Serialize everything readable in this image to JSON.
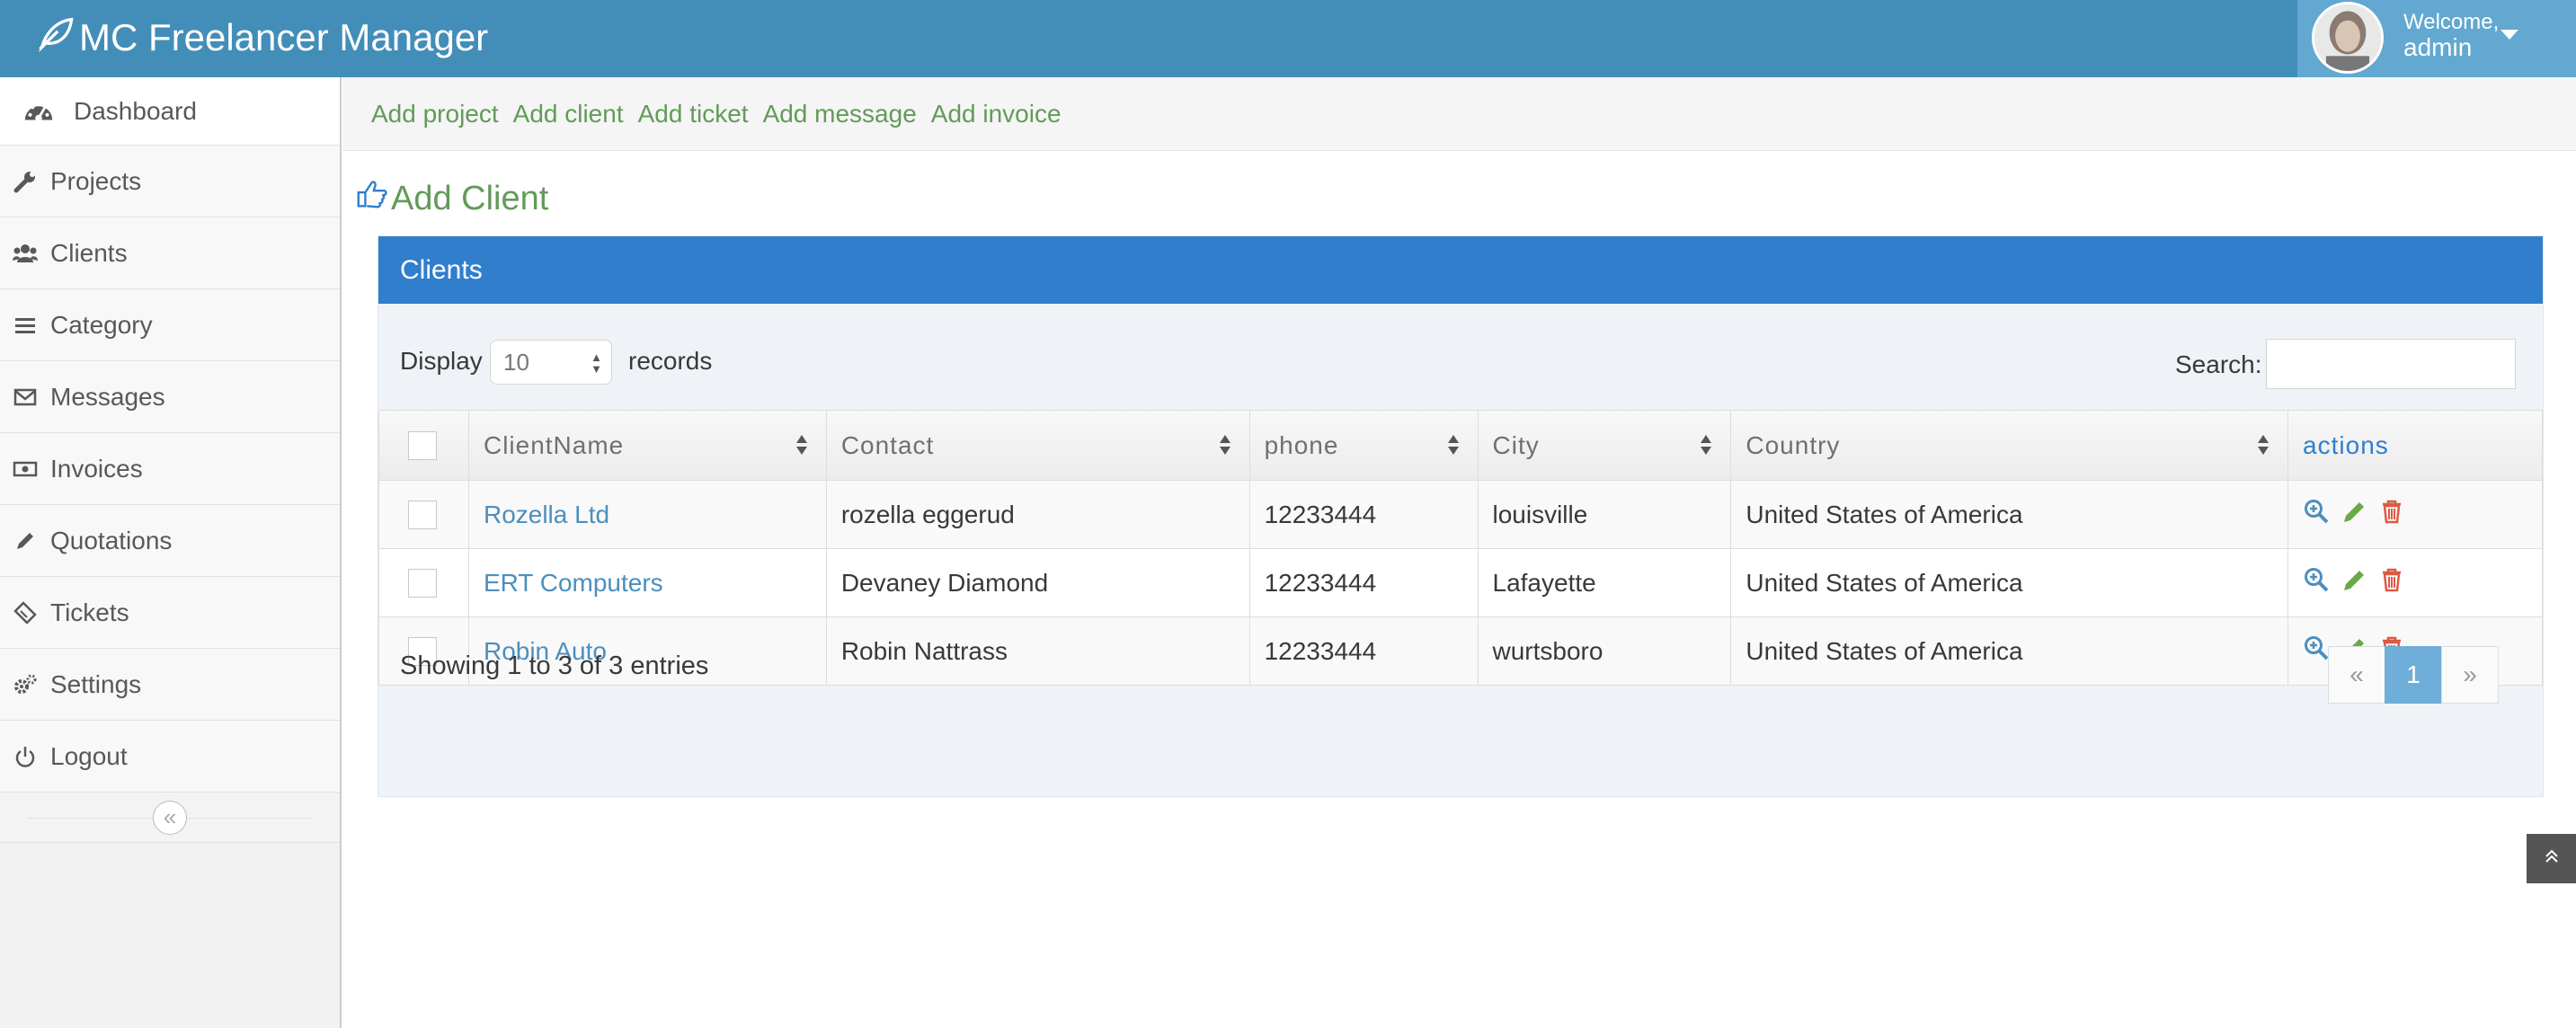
{
  "app": {
    "title": "MC Freelancer Manager"
  },
  "user": {
    "welcome": "Welcome,",
    "name": "admin"
  },
  "sidebar": {
    "items": [
      {
        "label": "Dashboard",
        "icon": "dashboard-icon"
      },
      {
        "label": "Projects",
        "icon": "wrench-icon"
      },
      {
        "label": "Clients",
        "icon": "users-icon"
      },
      {
        "label": "Category",
        "icon": "list-icon"
      },
      {
        "label": "Messages",
        "icon": "envelope-icon"
      },
      {
        "label": "Invoices",
        "icon": "money-icon"
      },
      {
        "label": "Quotations",
        "icon": "pencil-icon"
      },
      {
        "label": "Tickets",
        "icon": "ticket-icon"
      },
      {
        "label": "Settings",
        "icon": "cogs-icon"
      },
      {
        "label": "Logout",
        "icon": "power-icon"
      }
    ],
    "collapse_glyph": "«"
  },
  "shortcuts": [
    "Add project",
    "Add client",
    "Add ticket",
    "Add message",
    "Add invoice"
  ],
  "page": {
    "title": "Add Client"
  },
  "widget": {
    "title": "Clients",
    "display_label": "Display",
    "display_value": "10",
    "records_label": "records",
    "search_label": "Search:",
    "search_value": ""
  },
  "table": {
    "columns": [
      "ClientName",
      "Contact",
      "phone",
      "City",
      "Country",
      "actions"
    ],
    "rows": [
      {
        "name": "Rozella Ltd",
        "contact": "rozella eggerud",
        "phone": "12233444",
        "city": "louisville",
        "country": "United States of America"
      },
      {
        "name": "ERT Computers",
        "contact": "Devaney Diamond",
        "phone": "12233444",
        "city": "Lafayette",
        "country": "United States of America"
      },
      {
        "name": "Robin Auto",
        "contact": "Robin Nattrass",
        "phone": "12233444",
        "city": "wurtsboro",
        "country": "United States of America"
      }
    ],
    "action_icons": [
      "zoom-icon",
      "edit-icon",
      "trash-icon"
    ]
  },
  "footer": {
    "showing": "Showing 1 to 3 of 3 entries",
    "pager": {
      "prev": "«",
      "current": "1",
      "next": "»"
    }
  },
  "colors": {
    "navbar": "#438eb9",
    "widget_header": "#307ecc",
    "link_green": "#629b58",
    "link_blue": "#4c8fbd",
    "edit_green": "#69aa46",
    "delete_red": "#dd5a43"
  }
}
